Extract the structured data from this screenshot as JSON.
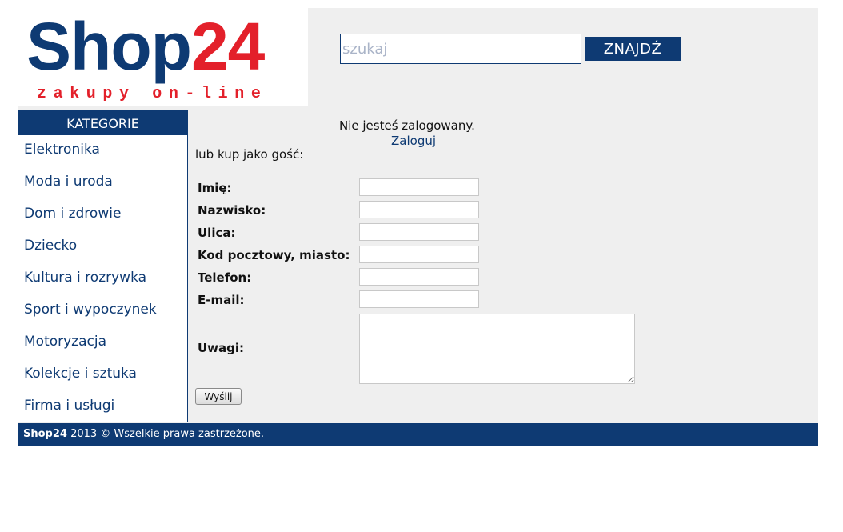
{
  "header": {
    "logo": {
      "word": "Shop",
      "number": "24",
      "tagline": "zakupy on-line"
    },
    "search": {
      "placeholder": "szukaj",
      "value": "",
      "button_label": "ZNAJDŹ"
    }
  },
  "sidebar": {
    "title": "KATEGORIE",
    "items": [
      {
        "label": "Elektronika"
      },
      {
        "label": "Moda i uroda"
      },
      {
        "label": "Dom i zdrowie"
      },
      {
        "label": "Dziecko"
      },
      {
        "label": "Kultura i rozrywka"
      },
      {
        "label": "Sport i wypoczynek"
      },
      {
        "label": "Motoryzacja"
      },
      {
        "label": "Kolekcje i sztuka"
      },
      {
        "label": "Firma i usługi"
      }
    ]
  },
  "main": {
    "login_status": "Nie jesteś zalogowany.",
    "login_link": "Zaloguj",
    "guest_label": "lub kup jako gość:",
    "form": {
      "fields": [
        {
          "label": "Imię:",
          "value": ""
        },
        {
          "label": "Nazwisko:",
          "value": ""
        },
        {
          "label": "Ulica:",
          "value": ""
        },
        {
          "label": "Kod pocztowy, miasto:",
          "value": ""
        },
        {
          "label": "Telefon:",
          "value": ""
        },
        {
          "label": "E-mail:",
          "value": ""
        }
      ],
      "notes": {
        "label": "Uwagi:",
        "value": ""
      },
      "submit_label": "Wyślij"
    }
  },
  "footer": {
    "brand": "Shop24",
    "text": " 2013 © Wszelkie prawa zastrzeżone."
  },
  "colors": {
    "brand_blue": "#0e3a73",
    "brand_red": "#e3202a",
    "page_background": "#efefef"
  }
}
